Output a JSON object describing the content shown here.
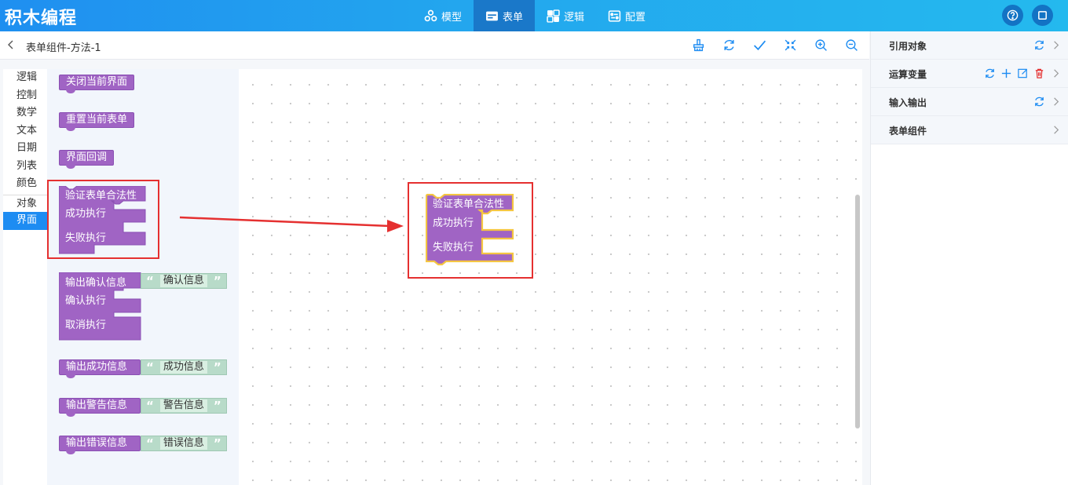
{
  "app": {
    "title": "积木编程"
  },
  "nav": {
    "tabs": [
      {
        "label": "模型",
        "icon": "model-icon",
        "active": false
      },
      {
        "label": "表单",
        "icon": "form-icon",
        "active": true
      },
      {
        "label": "逻辑",
        "icon": "logic-icon",
        "active": false
      },
      {
        "label": "配置",
        "icon": "config-icon",
        "active": false
      }
    ]
  },
  "editor": {
    "doc_title": "表单组件-方法-1",
    "toolbar": [
      "clean-icon",
      "refresh-icon",
      "check-icon",
      "collapse-icon",
      "zoom-in-icon",
      "zoom-out-icon"
    ]
  },
  "categories": [
    "逻辑",
    "控制",
    "数学",
    "文本",
    "日期",
    "列表",
    "颜色",
    "对象",
    "界面"
  ],
  "active_category": "界面",
  "flyout": {
    "close_screen": "关闭当前界面",
    "reset_form": "重置当前表单",
    "screen_callback": "界面回调",
    "validate": {
      "title": "验证表单合法性",
      "success": "成功执行",
      "fail": "失败执行"
    },
    "confirm": {
      "title": "输出确认信息",
      "value": "确认信息",
      "confirm": "确认执行",
      "cancel": "取消执行"
    },
    "success_msg": {
      "title": "输出成功信息",
      "value": "成功信息"
    },
    "warning_msg": {
      "title": "输出警告信息",
      "value": "警告信息"
    },
    "error_msg": {
      "title": "输出错误信息",
      "value": "错误信息"
    }
  },
  "workspace": {
    "validate": {
      "title": "验证表单合法性",
      "success": "成功执行",
      "fail": "失败执行"
    }
  },
  "right_panel": {
    "rows": [
      {
        "label": "引用对象"
      },
      {
        "label": "运算变量"
      },
      {
        "label": "输入输出"
      },
      {
        "label": "表单组件"
      }
    ]
  },
  "colors": {
    "topbar": "#1f8ff0",
    "block_purple": "#a064c4",
    "string_green": "#b8dbc9",
    "highlight_red": "#e53030",
    "selected_yellow": "#f4c542"
  }
}
